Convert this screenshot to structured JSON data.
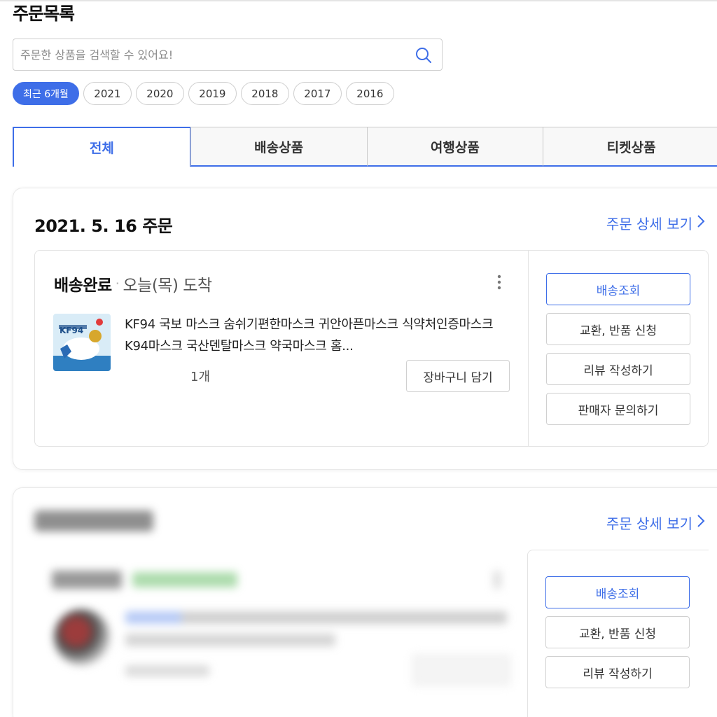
{
  "page": {
    "title": "주문목록"
  },
  "search": {
    "placeholder": "주문한 상품을 검색할 수 있어요!",
    "value": "",
    "icon": "search-icon"
  },
  "filters": {
    "years": [
      "최근 6개월",
      "2021",
      "2020",
      "2019",
      "2018",
      "2017",
      "2016"
    ],
    "active_index": 0
  },
  "tabs": [
    {
      "label": "전체",
      "active": true
    },
    {
      "label": "배송상품",
      "active": false
    },
    {
      "label": "여행상품",
      "active": false
    },
    {
      "label": "티켓상품",
      "active": false
    }
  ],
  "colors": {
    "accent": "#3e6ee8",
    "border": "#d0d0d0",
    "text": "#111111"
  },
  "orders": [
    {
      "date": "2021. 5. 16 주문",
      "detail_link": "주문 상세 보기",
      "status": "배송완료",
      "arrival": "오늘(목) 도착",
      "product": {
        "name": "KF94 국보 마스크 숨쉬기편한마스크 귀안아픈마스크 식약처인증마스크 K94마스크 국산덴탈마스크 약국마스크 홈...",
        "quantity": "1개",
        "thumb_label": "KF94"
      },
      "cart_button": "장바구니 담기",
      "actions": [
        "배송조회",
        "교환, 반품 신청",
        "리뷰 작성하기",
        "판매자 문의하기"
      ]
    },
    {
      "detail_link": "주문 상세 보기",
      "actions": [
        "배송조회",
        "교환, 반품 신청",
        "리뷰 작성하기"
      ]
    }
  ]
}
